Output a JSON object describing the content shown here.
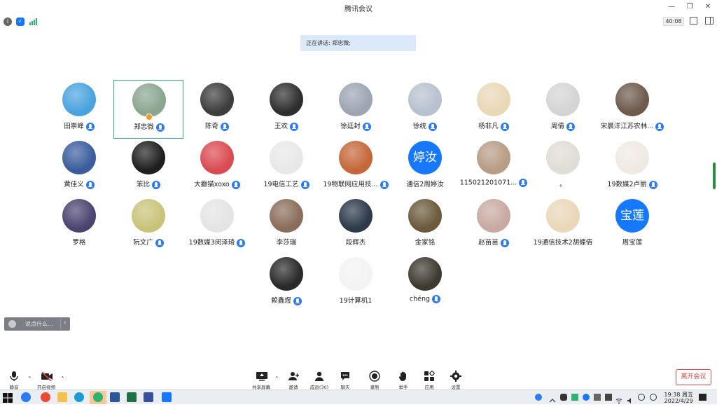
{
  "window": {
    "title": "腾讯会议"
  },
  "toolbar": {
    "timer": "40:08"
  },
  "speaking": {
    "label": "正在讲话: 郑忠微;"
  },
  "participants": [
    {
      "name": "田崇峰",
      "mic": true
    },
    {
      "name": "郑忠微",
      "mic": true,
      "active": true
    },
    {
      "name": "陈奇",
      "mic": true
    },
    {
      "name": "王欢",
      "mic": true
    },
    {
      "name": "徐廷封",
      "mic": true
    },
    {
      "name": "徐统",
      "mic": true
    },
    {
      "name": "杨非凡",
      "mic": true
    },
    {
      "name": "周倩",
      "mic": true
    },
    {
      "name": "宋晨洋江苏农林...",
      "mic": true
    },
    {
      "name": "黄佳义",
      "mic": true
    },
    {
      "name": "笨比",
      "mic": true
    },
    {
      "name": "大癫猫xoxo",
      "mic": true
    },
    {
      "name": "19电信工艺",
      "mic": true
    },
    {
      "name": "19物联网应用技...",
      "mic": true
    },
    {
      "name": "通信2周婷汝",
      "mic": false,
      "avatar_text": "婷汝"
    },
    {
      "name": "115021201071...",
      "mic": true
    },
    {
      "name": "。",
      "mic": false
    },
    {
      "name": "19数媒2卢丽",
      "mic": true
    },
    {
      "name": "罗格",
      "mic": false
    },
    {
      "name": "阮文广",
      "mic": true
    },
    {
      "name": "19数媒3闵泽琦",
      "mic": true
    },
    {
      "name": "李莎瑞",
      "mic": false
    },
    {
      "name": "段辉杰",
      "mic": false
    },
    {
      "name": "金家铭",
      "mic": false
    },
    {
      "name": "赵苗苗",
      "mic": true
    },
    {
      "name": "19通信技术2胡蝶倩",
      "mic": false
    },
    {
      "name": "周宝莲",
      "mic": false,
      "avatar_text": "宝莲"
    },
    {
      "name": "赖鑫煜",
      "mic": true
    },
    {
      "name": "19计算机1",
      "mic": false
    },
    {
      "name": "chéng",
      "mic": true
    }
  ],
  "chat": {
    "placeholder": "说点什么..."
  },
  "controls": {
    "mute": "静音",
    "video": "开启视频",
    "share": "共享屏幕",
    "invite": "邀请",
    "members": "成员(30)",
    "chat": "聊天",
    "record": "录制",
    "raise_hand": "举手",
    "apps": "应用",
    "settings": "设置",
    "leave": "离开会议"
  },
  "taskbar": {
    "time": "19:38 周五",
    "date": "2022/4/29"
  },
  "colors": {
    "accent": "#1677ff",
    "active_border": "#2fb36f",
    "leave": "#e64545"
  }
}
